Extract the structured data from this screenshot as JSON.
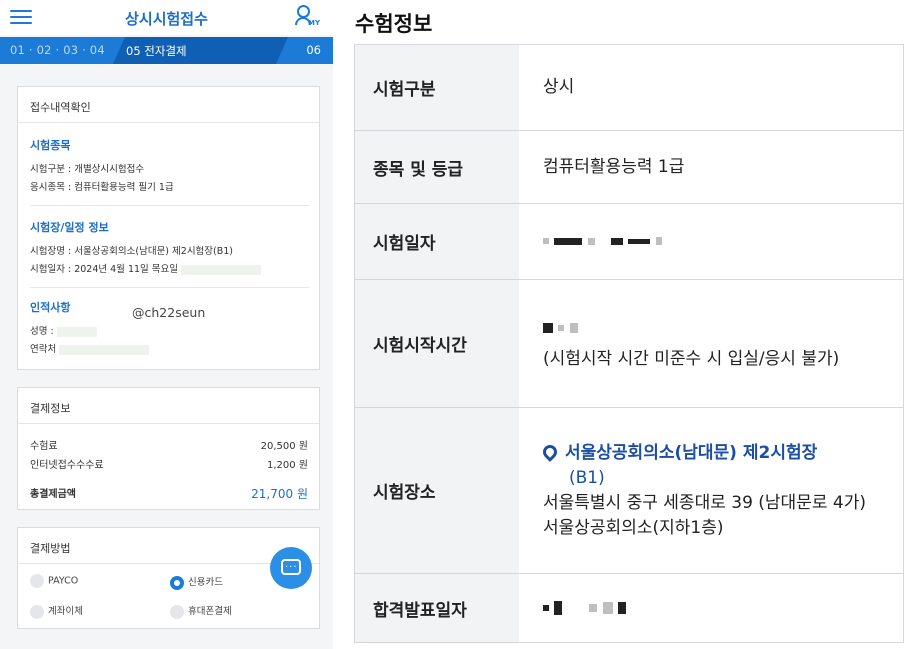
{
  "app": {
    "title": "상시시험접수",
    "my_label": "MY"
  },
  "steps": {
    "done": "01 · 02 · 03 · 04",
    "current": "05 전자결제",
    "next": "06"
  },
  "receipt": {
    "header": "접수내역확인",
    "exam_section_title": "시험종목",
    "exam_type_line": "시험구분 : 개별상시시험접수",
    "exam_item_line": "응시종목 : 컴퓨터활용능력 필기 1급",
    "venue_section_title": "시험장/일정 정보",
    "venue_line": "시험장명 : 서울상공회의소(남대문) 제2시험장(B1)",
    "date_line": "시험일자 : 2024년 4월 11일 목요일",
    "person_section_title": "인적사항",
    "name_label": "성명 :",
    "contact_label": "연락처",
    "watermark": "@ch22seun"
  },
  "payment_info": {
    "header": "결제정보",
    "fee_label": "수험료",
    "fee_value": "20,500 원",
    "online_fee_label": "인터넷접수수수료",
    "online_fee_value": "1,200 원",
    "total_label": "총결제금액",
    "total_value": "21,700 원"
  },
  "payment_method": {
    "header": "결제방법",
    "options": [
      {
        "label": "PAYCO",
        "selected": false
      },
      {
        "label": "신용카드",
        "selected": true
      },
      {
        "label": "계좌이체",
        "selected": false
      },
      {
        "label": "휴대폰결제",
        "selected": false
      }
    ]
  },
  "exam_info": {
    "title": "수험정보",
    "rows": {
      "category_label": "시험구분",
      "category_value": "상시",
      "grade_label": "종목 및 등급",
      "grade_value": "컴퓨터활용능력 1급",
      "date_label": "시험일자",
      "start_label": "시험시작시간",
      "start_note": "(시험시작 시간 미준수 시 입실/응시 불가)",
      "venue_label": "시험장소",
      "venue_name": "서울상공회의소(남대문) 제2시험장",
      "venue_floor": "(B1)",
      "venue_address": "서울특별시 중구 세종대로 39 (남대문로 4가) 서울상공회의소(지하1층)",
      "result_label": "합격발표일자"
    }
  },
  "colors": {
    "brand_blue": "#1c7bd6",
    "step_current": "#0f5fb5",
    "venue_blue": "#1c4fa3"
  }
}
